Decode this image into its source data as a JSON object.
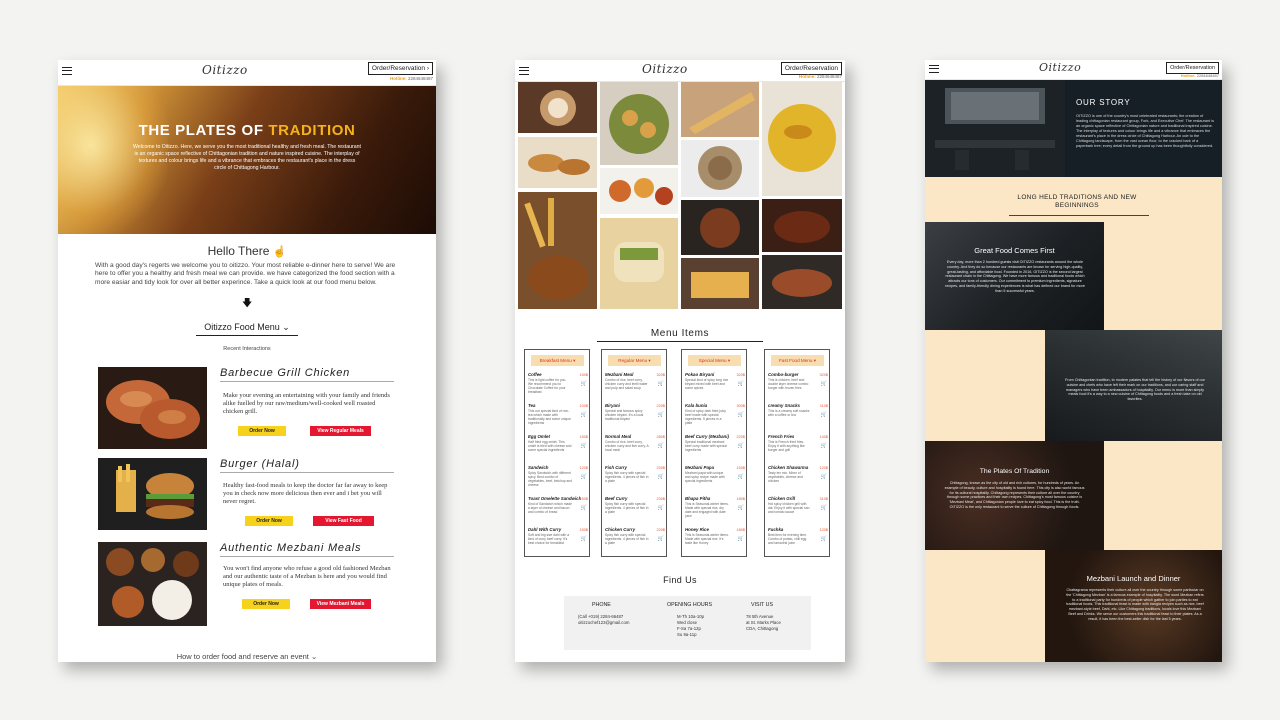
{
  "header": {
    "logo": "Oitizzo",
    "order_button": "Order/Reservation",
    "hotline_label": "Hotline:",
    "hotline_number": "2284648487"
  },
  "home": {
    "hero_title_white": "THE PLATES OF",
    "hero_title_gold": "TRADITION",
    "hero_text": "Welcome to Oitizzo. Here, we serve you the most traditional healthy and fresh meal. The restaurant is an organic space reflective of Chittagonian tradition and nature inspired cuisine. The interplay of textures and colour brings life and a vibrance that embraces the restaurant's place in the dress circle of Chittagong Harbour.",
    "hello_title": "Hello There",
    "hello_text": "With a good day's regerts we welcome you to oitizzo. Your most reliable e-dinner here to serve! We are here to offer you a healthy and fresh meal we can provide. we have categorized the food section with a more easiar and tidy look for over all better experince. Take a quick look at our food menu below.",
    "food_menu_title": "Oitizzo Food Menu",
    "recent_label": "Recent Interactions",
    "items": [
      {
        "title": "Barbecue Grill Chicken",
        "desc": "Make your evening an entertaining with your family and friends alike fuelled by our raw/medium/well-cooked well roasted chicken grill.",
        "order": "Order Now",
        "view": "View Regular Meals"
      },
      {
        "title": "Burger (Halal)",
        "desc": "Healthy fast-food meals to keep the doctor far far away to keep you in check now more delicious then ever and i bet you will never regret.",
        "order": "Order Now",
        "view": "View Fast Food"
      },
      {
        "title": "Authentic Mezbani Meals",
        "desc": "You won't find anyone who refuse a good old fashioned Mezban and our authentic taste of a Mezban is here and you would find unique plates of meals.",
        "order": "Order Now",
        "view": "View Mezbani Meals"
      }
    ],
    "howto": "How to order food and reserve an event"
  },
  "menu_page": {
    "heading": "Menu Items",
    "columns": [
      {
        "tag": "Breakfast Menu",
        "rows": [
          {
            "name": "Coffee",
            "desc": "This is light coffee for you. We recommend you to Chocolate Coffee for your breakfast",
            "price": "150$"
          },
          {
            "name": "Tea",
            "desc": "This our special kind of non-tea which made with traditionally and some unique ingredients",
            "price": "100$"
          },
          {
            "name": "Egg Omlet",
            "desc": "Half fried egg omlet. This omlet is fried with cheese and some special ingredients",
            "price": "150$"
          },
          {
            "name": "Sandwich",
            "desc": "Spicy Sandwich with different spicy. Best combo of vegetables, beef, ketchup and cheese",
            "price": "120$"
          },
          {
            "name": "Toast Omelette Sandwich",
            "desc": "Kind of Sandwich which made a layer of cheese and bacon and combo of bread",
            "price": "150$"
          },
          {
            "name": "Dahl With Curry",
            "desc": "Soft and big size dahl with a kind of curry beef curry. It's best choice for breakfast",
            "price": "150$"
          }
        ]
      },
      {
        "tag": "Regular Menu",
        "rows": [
          {
            "name": "Mezbani Meal",
            "desc": "Combo of rice, beef curry, chicken curry and lentil water and pulp and salad soup",
            "price": "320$"
          },
          {
            "name": "Biryani",
            "desc": "Special and famous spicy chicken biryani. It's a local traditional biryani",
            "price": "220$"
          },
          {
            "name": "Normal Meal",
            "desc": "Combo of rice, beef curry, chicken curry and fish curry. A local meal",
            "price": "280$"
          },
          {
            "name": "Fish Curry",
            "desc": "Spicy fish curry with special ingredients. 4 pieces of fish in a plate",
            "price": "230$"
          },
          {
            "name": "Beef Curry",
            "desc": "Spicy fish curry with special ingredients. 4 pieces of fish in a plate",
            "price": "230$"
          },
          {
            "name": "Chicken Curry",
            "desc": "Spicy fish curry with special ingredients. 4 pieces of fish in a plate",
            "price": "220$"
          }
        ]
      },
      {
        "tag": "Special Menu",
        "rows": [
          {
            "name": "Pokao Biryani",
            "desc": "Special kind of spicy long rice biryani mixed with beef and some spices",
            "price": "320$"
          },
          {
            "name": "Kala bunia",
            "desc": "Kind of spicy dark fried juicy beef made with special ingredients. 5 pieces in a plate",
            "price": "300$"
          },
          {
            "name": "Beef Curry (Mezbani)",
            "desc": "Special traditional mezbani beef curry made with special ingredients",
            "price": "220$"
          },
          {
            "name": "Mezbani Papa",
            "desc": "Mezbani papa with unique and spicy recipe made with special ingredients",
            "price": "150$"
          },
          {
            "name": "Bhapa Pitha",
            "desc": "This is Seasonal-winter items. Made with special rice, dry date and engaged with date juice",
            "price": "180$"
          },
          {
            "name": "Honey Rice",
            "desc": "This is Seasonal-winter items. Made with special rice. It's taste like Honey",
            "price": "180$"
          }
        ]
      },
      {
        "tag": "Fast Food Menu",
        "rows": [
          {
            "name": "Combo-burger",
            "desc": "This is chicken, beef and double layer cheese combo burger with frozen fries",
            "price": "320$"
          },
          {
            "name": "creamy Snacks",
            "desc": "This is a creamy soft snacks with a coffee or tea",
            "price": "110$"
          },
          {
            "name": "French Fries",
            "desc": "This is French fried fries. Enjoy it with anything like burger and grill",
            "price": "140$"
          },
          {
            "name": "Chicken Shawarma",
            "desc": "Tasty tex mix. Mixer of vegetables, cheese and chicken",
            "price": "120$"
          },
          {
            "name": "Chicken Grill",
            "desc": "Hot spicy chicken grill with dal. Enjoy it with special nan and tomato sauce",
            "price": "310$"
          },
          {
            "name": "Fuchka",
            "desc": "Best item for evening time. Combo of potato, chili egg and tamarind juice",
            "price": "120$"
          }
        ]
      }
    ],
    "find_title": "Find Us",
    "phone_h": "PHONE",
    "phone_lines": "(Call +019) 2284-66487\noitizzochef123@gmail.com",
    "hours_h": "OPENING HOURS",
    "hours_lines": "M-Th 10a-10p\nWed close\nF-Sa 7a-12p\nSu 9a-11p",
    "visit_h": "VISIT US",
    "visit_lines": "78 5th Avenue\nat St. Marks Place\nCDA, Chittagong"
  },
  "about_page": {
    "story_title": "OUR STORY",
    "story_text": "OITIZZO is one of the country's most celebrated restaurants; the creation of leading chittagonian restaurant group, Fork, and Executive Chef. The restaurant is an organic space reflective of Chittagonian nature and traditional inspired cuisine. The interplay of textures and colour brings life and a vibrance that embraces the restaurant's place in the dress circle of Chittagong Harbour. An ode to the Chittagong landscape, from the vast ocean floor, to the cracked bark of a paperbark tree; every detail from the ground up has been thoughtfully considered.",
    "trad_title": "LONG HELD TRADITIONS AND NEW BEGINNINGS",
    "great_title": "Great Food Comes First",
    "great_text": "Every day, more than 2 hundred guests visit OITIZZO restaurants around the whole country. And they do so because our restaurants are known for serving high-quality, great-tasting, and affordable food. Founded in 2016, OITIZZO is the second largest restaurant chain in the Chittagong. We have more famous and traditional foods which attracts our tons of customers. Our commitment to premium ingredients, signature recipes, and family-friendly dining experiences is what has defined our brand for more than 5 successful years.",
    "mid_text": "From Chittagonian tradition, to modern palates that tell the history of our flavors of our cuisine and chefs who have left their mark on our traditions, and our caring staff and managers who have been ambassadors of hospitality. Our menu is more than simply meals food it's a way to a new cuisine of Chittagong foods and a fresh take on old favorites.",
    "plates_title": "The Plates Of Tradition",
    "plates_text": "Chittagong, known as the city of old and rich cultures, for hundreds of years. An example of beauty, culture and hospitality is found here. This city is also world famous for its cultural hospitality. Chittagong represents their culture all over the country through some practices and their own recipes. Chittagong's most famous cuisine is 'Mezbani Meat', and Chittagonian people love to eat spicy food. This is the truth. OITIZZO is the only restaurant to serve the culture of Chittagong through foods.",
    "mezbani_title": "Mezbani Launch and Dinner",
    "mezbani_text": "Chattagrama represents their culture all over the country through some particular on the 'Chittagong Mezban' is a famous example of hospitality. The word Mezban refers to a traditional party for hundreds of people which gather to join parties to eat traditional foods. This traditional feast is made with bangla recipes such as rice, beef mezbani-style beef, Dahl, etc. Like Chittagong traditions, locals love this Mezbani Beef and Drinks. We serve our customers this traditional feast to their plates. As a result, it has been the best-seller dish for the last 5 years."
  },
  "colors": {
    "accent_gold": "#f6b21b",
    "btn_yellow": "#f7d21c",
    "btn_red": "#e5162f",
    "cream": "#fbe7c6",
    "price": "#e2583a"
  }
}
